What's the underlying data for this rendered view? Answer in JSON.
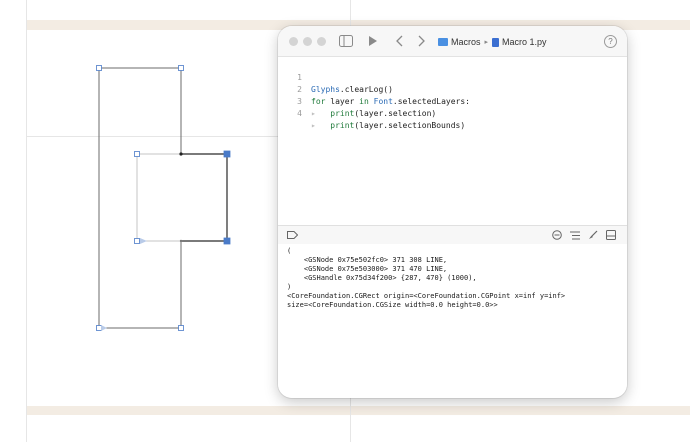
{
  "titlebar": {
    "breadcrumb_folder": "Macros",
    "breadcrumb_file": "Macro 1.py",
    "help_label": "?"
  },
  "editor": {
    "lines": [
      {
        "num": "1",
        "text": "Glyphs.clearLog()"
      },
      {
        "num": "2",
        "text": "for layer in Font.selectedLayers:"
      },
      {
        "num": "3",
        "text": "print(layer.selection)"
      },
      {
        "num": "4",
        "text": "print(layer.selectionBounds)"
      }
    ]
  },
  "console": {
    "lines": [
      "(",
      "    <GSNode 0x75e502fc0> 371 308 LINE,",
      "    <GSNode 0x75e503000> 371 470 LINE,",
      "    <GSHandle 0x75d34f200> {287, 470} (1000),",
      ")",
      "<CoreFoundation.CGRect origin=<CoreFoundation.CGPoint x=inf y=inf>",
      "size=<CoreFoundation.CGSize width=0.0 height=0.0>>"
    ]
  },
  "colors": {
    "accent_blue": "#4a7bc8",
    "band": "#f3ece3",
    "keyword_green": "#1f7a3a",
    "object_blue": "#2b6bb5"
  }
}
